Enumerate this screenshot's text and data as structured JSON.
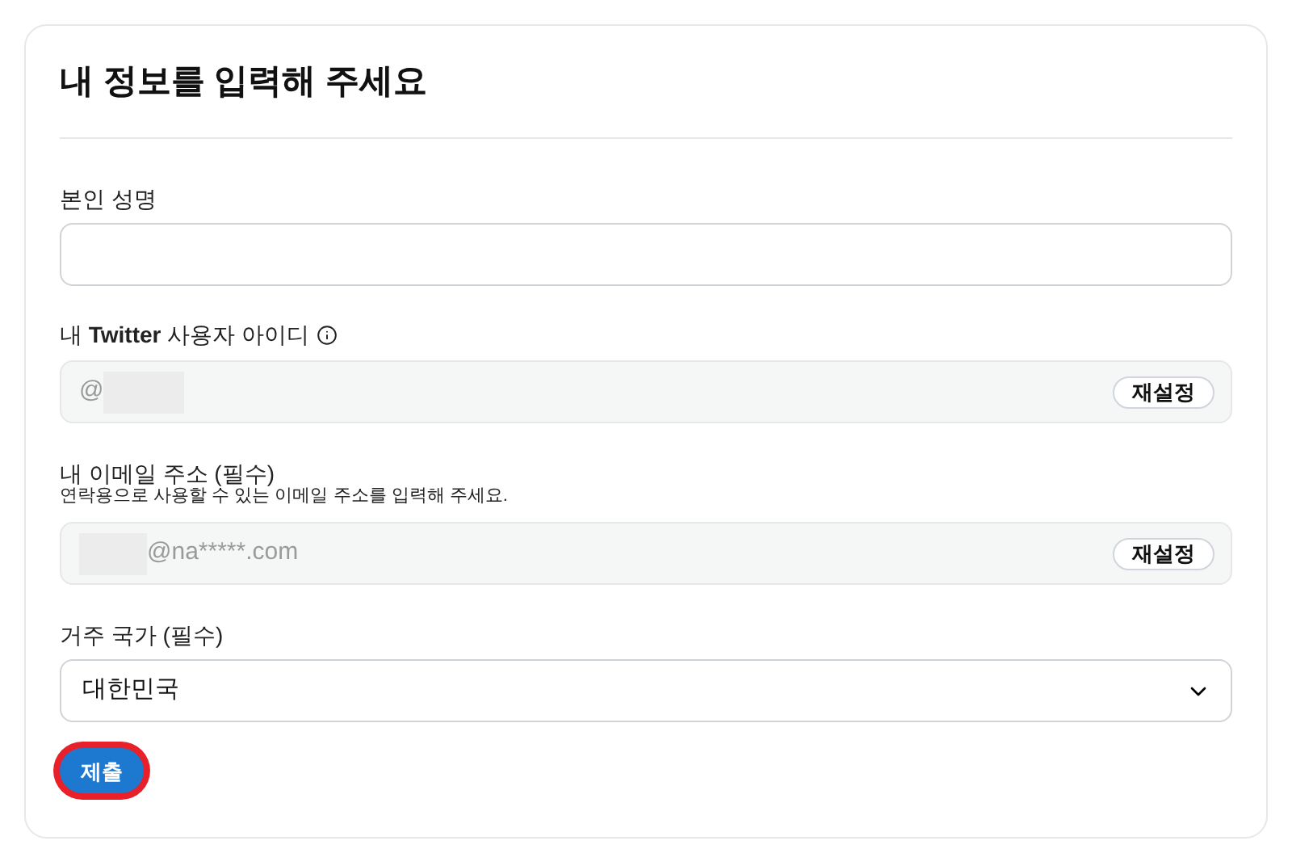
{
  "title": "내 정보를 입력해 주세요",
  "name_field": {
    "label": "본인 성명"
  },
  "twitter_field": {
    "label_prefix": "내",
    "label_brand": "Twitter",
    "label_suffix": "사용자 아이디",
    "value": "@",
    "redacted": true,
    "button": "재설정"
  },
  "email_field": {
    "label": "내 이메일 주소 (필수)",
    "hint": "연락용으로 사용할 수 있는 이메일 주소를 입력해 주세요.",
    "value": "@na*****.com",
    "redacted": true,
    "button": "재설정"
  },
  "country_field": {
    "label": "거주 국가 (필수)",
    "value": "대한민국"
  },
  "submit": {
    "label": "제출",
    "highlighted": true
  }
}
